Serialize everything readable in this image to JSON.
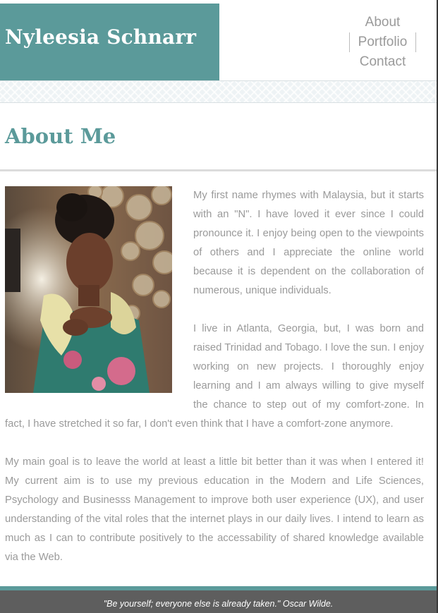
{
  "header": {
    "brand_name": "Nyleesia Schnarr",
    "nav": [
      {
        "label": "About"
      },
      {
        "label": "Portfolio"
      },
      {
        "label": "Contact"
      }
    ]
  },
  "main": {
    "title": "About Me",
    "photo": {
      "name": "profile-photo"
    },
    "paragraphs": [
      "My first name rhymes with Malaysia, but it starts with an \"N\". I have loved it ever since I could pronounce it. I enjoy being open to the viewpoints of others and I appreciate the online world because it is dependent on the collaboration of numerous, unique individuals.",
      "I live in Atlanta, Georgia, but, I was born and raised Trinidad and Tobago. I love the sun. I enjoy working on new projects. I thoroughly enjoy learning and I am always willing to give myself the chance to step out of my comfort-zone. In fact, I have stretched it so far, I don't even think that I have a comfort-zone anymore.",
      "My main goal is to leave the world at least a little bit better than it was when I entered it! My current aim is to use my previous education in the Modern and Life Sciences, Psychology and Businesss Management to improve both user experience (UX), and user understanding of the vital roles that the internet plays in our daily lives. I intend to learn as much as I can to contribute positively to the accessability of shared knowledge available via the Web."
    ]
  },
  "footer": {
    "quote": "\"Be yourself; everyone else is already taken.\" Oscar Wilde."
  },
  "colors": {
    "accent": "#5b9a9a",
    "body_text": "#9a9a9a",
    "footer_bg": "#5e5e5e"
  }
}
